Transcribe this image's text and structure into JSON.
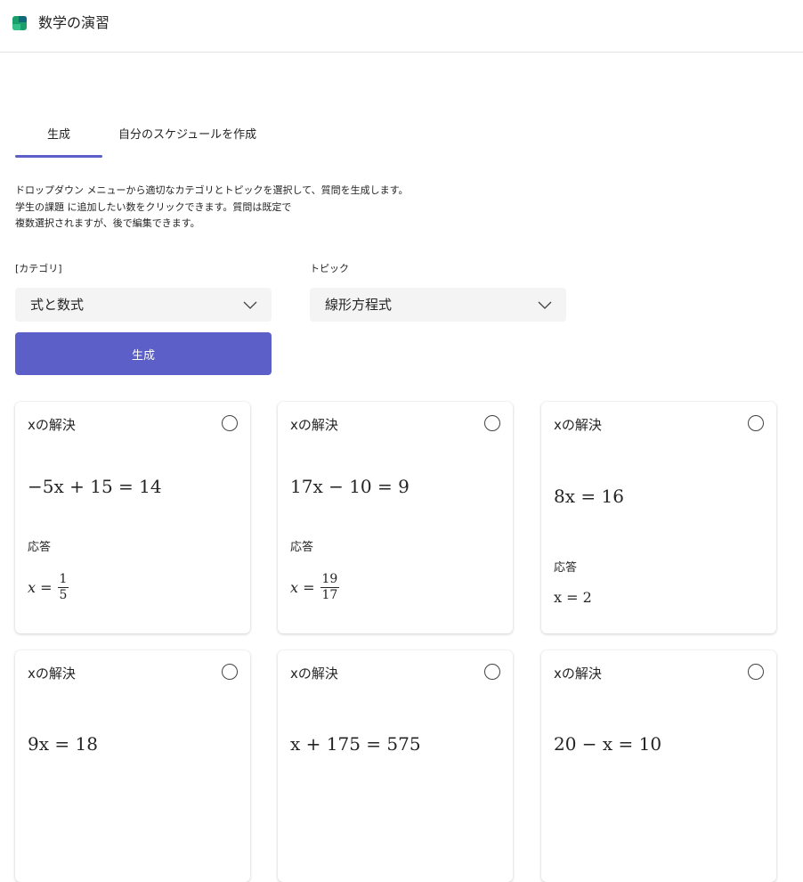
{
  "app": {
    "title": "数学の演習"
  },
  "tabs": [
    {
      "label": "生成"
    },
    {
      "label": "自分のスケジュールを作成"
    }
  ],
  "description": [
    "ドロップダウン メニューから適切なカテゴリとトピックを選択して、質問を生成します。",
    "学生の課題 に追加したい数をクリックできます。質問は既定で",
    "複数選択されますが、後で編集できます。"
  ],
  "category": {
    "label": "[カテゴリ]",
    "value": "式と数式"
  },
  "topic": {
    "label": "トピック",
    "value": "線形方程式"
  },
  "generate_button": "生成",
  "answer_label": "応答",
  "cards": [
    {
      "title": "xの解決",
      "equation": "−5x + 15 = 14",
      "answer_prefix": "x =",
      "answer_num": "1",
      "answer_den": "5"
    },
    {
      "title": "xの解決",
      "equation": "17x − 10 = 9",
      "answer_prefix": "x =",
      "answer_num": "19",
      "answer_den": "17"
    },
    {
      "title": "xの解決",
      "equation": "8x = 16",
      "answer": "x = 2"
    },
    {
      "title": "xの解決",
      "equation": "9x = 18"
    },
    {
      "title": "xの解決",
      "equation": "x + 175 = 575"
    },
    {
      "title": "xの解決",
      "equation": "20 − x = 10"
    }
  ],
  "colors": {
    "accent": "#5b5fc7",
    "dropdown_bg": "#f4f4f4"
  }
}
